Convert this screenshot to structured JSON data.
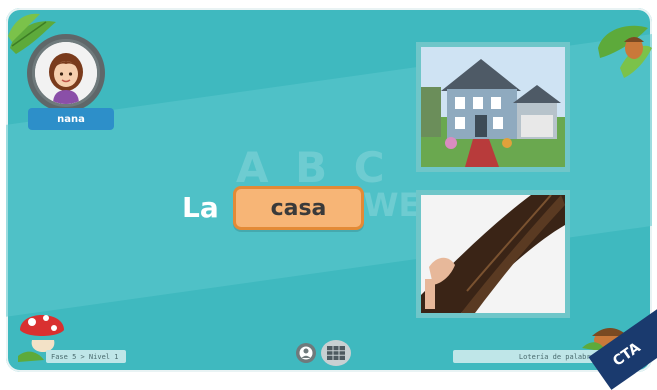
{
  "player": {
    "name": "nana"
  },
  "phrase": {
    "article": "La",
    "word": "casa"
  },
  "watermark": {
    "letters": "A B C",
    "word": "OWE"
  },
  "cards": [
    {
      "image": "house-photo"
    },
    {
      "image": "hair-photo"
    }
  ],
  "footer": {
    "level": "Fase 5 > Nivel 1",
    "game_name": "Lotería de palabras"
  },
  "corner_badge": "CTA",
  "colors": {
    "background": "#3fb9bf",
    "word_box": "#f7b576",
    "word_box_border": "#e38a36",
    "name_badge": "#2d8fc9",
    "cta": "#1a3a6e"
  },
  "icons": [
    "leaf-icon",
    "mushroom-icon",
    "acorn-icon",
    "profile-icon",
    "grid-icon"
  ]
}
